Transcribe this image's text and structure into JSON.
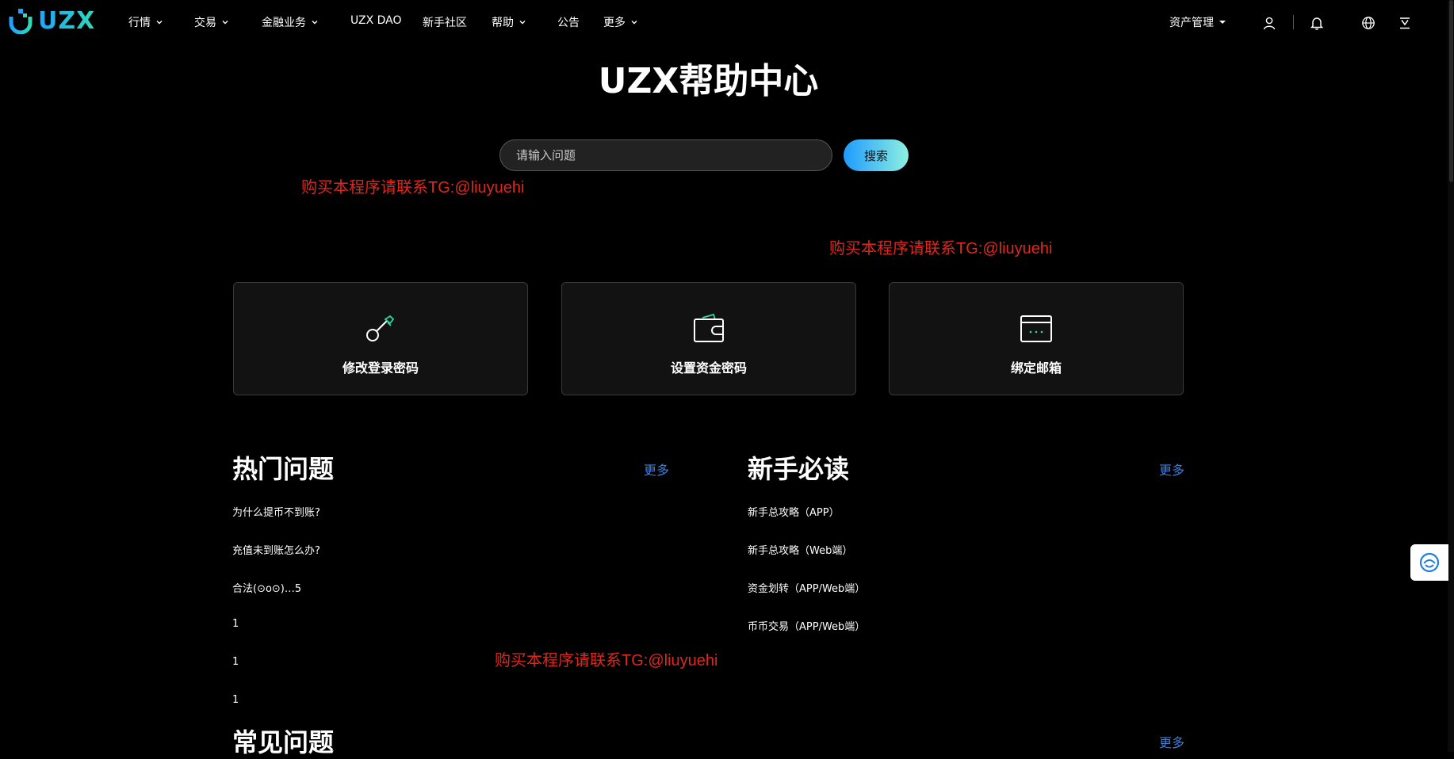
{
  "brand": {
    "logo_text": "UZX"
  },
  "nav": {
    "items": [
      {
        "label": "行情",
        "dropdown": true
      },
      {
        "label": "交易",
        "dropdown": true
      },
      {
        "label": "金融业务",
        "dropdown": true
      },
      {
        "label": "UZX DAO",
        "dropdown": false
      },
      {
        "label": "新手社区",
        "dropdown": false
      },
      {
        "label": "帮助",
        "dropdown": true
      },
      {
        "label": "公告",
        "dropdown": false
      },
      {
        "label": "更多",
        "dropdown": true
      }
    ],
    "asset_menu": "资产管理",
    "icons": [
      "user-icon",
      "bell-icon",
      "globe-icon",
      "download-icon"
    ]
  },
  "hero": {
    "title": "UZX帮助中心",
    "search_placeholder": "请输入问题",
    "search_button": "搜索"
  },
  "watermarks": [
    "购买本程序请联系TG:@liuyuehi",
    "购买本程序请联系TG:@liuyuehi",
    "购买本程序请联系TG:@liuyuehi"
  ],
  "quick_cards": [
    {
      "label": "修改登录密码",
      "icon": "key-icon"
    },
    {
      "label": "设置资金密码",
      "icon": "wallet-icon"
    },
    {
      "label": "绑定邮箱",
      "icon": "email-card-icon"
    }
  ],
  "hot": {
    "title": "热门问题",
    "more": "更多",
    "items": [
      "为什么提币不到账?",
      "充值未到账怎么办?",
      "合法(⊙o⊙)…5",
      "1",
      "1",
      "1"
    ]
  },
  "newbie": {
    "title": "新手必读",
    "more": "更多",
    "items": [
      "新手总攻略（APP）",
      "新手总攻略（Web端）",
      "资金划转（APP/Web端）",
      "币币交易（APP/Web端）"
    ]
  },
  "faq": {
    "title": "常见问题",
    "more": "更多"
  },
  "colors": {
    "accent_blue": "#3b7fe0",
    "watermark_red": "#e0261e",
    "icon_green": "#2fd9a0",
    "background": "#000000"
  }
}
